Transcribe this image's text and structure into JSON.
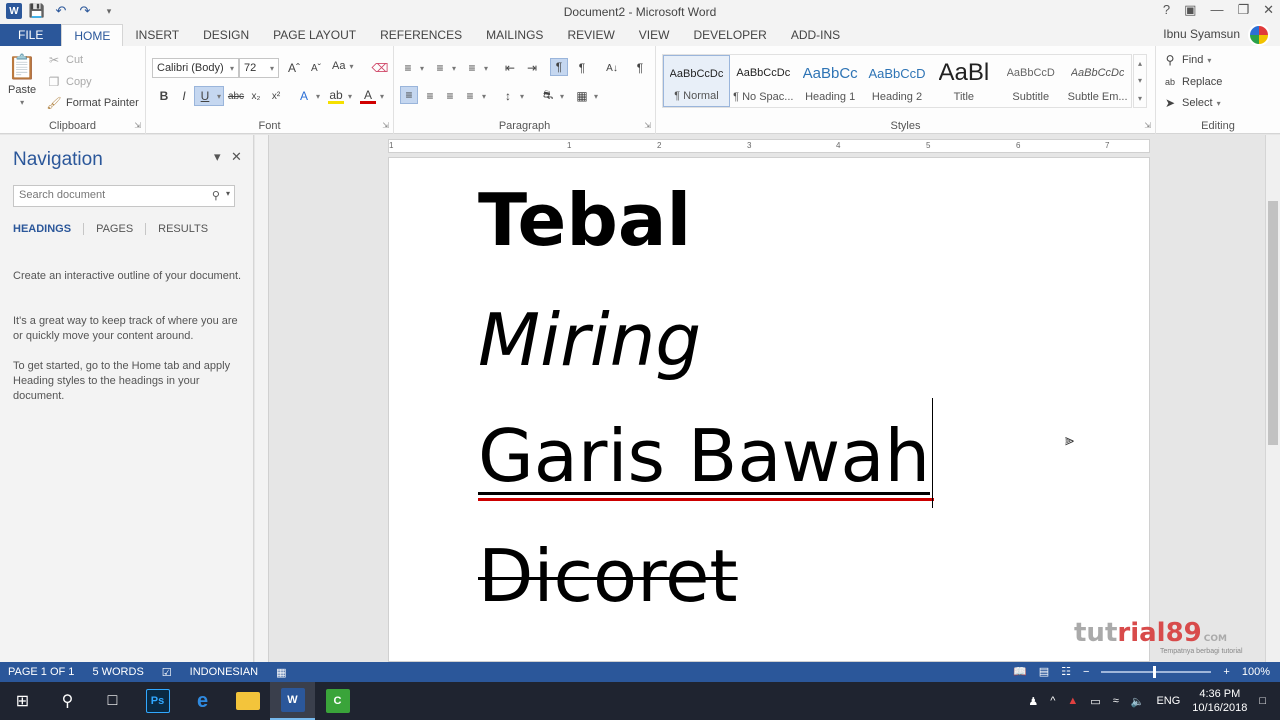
{
  "window": {
    "title": "Document2 - Microsoft Word",
    "user": "Ibnu Syamsun"
  },
  "tabs": [
    "FILE",
    "HOME",
    "INSERT",
    "DESIGN",
    "PAGE LAYOUT",
    "REFERENCES",
    "MAILINGS",
    "REVIEW",
    "VIEW",
    "DEVELOPER",
    "ADD-INS"
  ],
  "ribbon": {
    "clipboard": {
      "label": "Clipboard",
      "paste": "Paste",
      "cut": "Cut",
      "copy": "Copy",
      "format_painter": "Format Painter"
    },
    "font": {
      "label": "Font",
      "font_name": "Calibri (Body)",
      "font_size": "72",
      "change_case": "Aa"
    },
    "paragraph": {
      "label": "Paragraph"
    },
    "styles": {
      "label": "Styles",
      "items": [
        {
          "preview": "AaBbCcDc",
          "name": "¶ Normal"
        },
        {
          "preview": "AaBbCcDc",
          "name": "¶ No Spac..."
        },
        {
          "preview": "AaBbCc",
          "name": "Heading 1"
        },
        {
          "preview": "AaBbCcD",
          "name": "Heading 2"
        },
        {
          "preview": "AaBl",
          "name": "Title"
        },
        {
          "preview": "AaBbCcD",
          "name": "Subtitle"
        },
        {
          "preview": "AaBbCcDc",
          "name": "Subtle Em..."
        }
      ]
    },
    "editing": {
      "label": "Editing",
      "find": "Find",
      "replace": "Replace",
      "select": "Select"
    }
  },
  "nav": {
    "title": "Navigation",
    "search_placeholder": "Search document",
    "tabs": [
      "HEADINGS",
      "PAGES",
      "RESULTS"
    ],
    "p1": "Create an interactive outline of your document.",
    "p2": "It's a great way to keep track of where you are or quickly move your content around.",
    "p3": "To get started, go to the Home tab and apply Heading styles to the headings in your document."
  },
  "document": {
    "line1": "Tebal",
    "line2": "Miring",
    "line3": "Garis Bawah",
    "line4": "Dicoret"
  },
  "ruler": [
    "1",
    "1",
    "2",
    "3",
    "4",
    "5",
    "6",
    "7"
  ],
  "status": {
    "page": "PAGE 1 OF 1",
    "words": "5 WORDS",
    "language": "INDONESIAN",
    "zoom": "100%"
  },
  "watermark": {
    "text_a": "tut",
    "text_b": "rial89",
    "suffix": "COM",
    "tagline": "Tempatnya berbagi tutorial"
  },
  "taskbar": {
    "lang": "ENG",
    "time": "4:36 PM",
    "date": "10/16/2018"
  }
}
